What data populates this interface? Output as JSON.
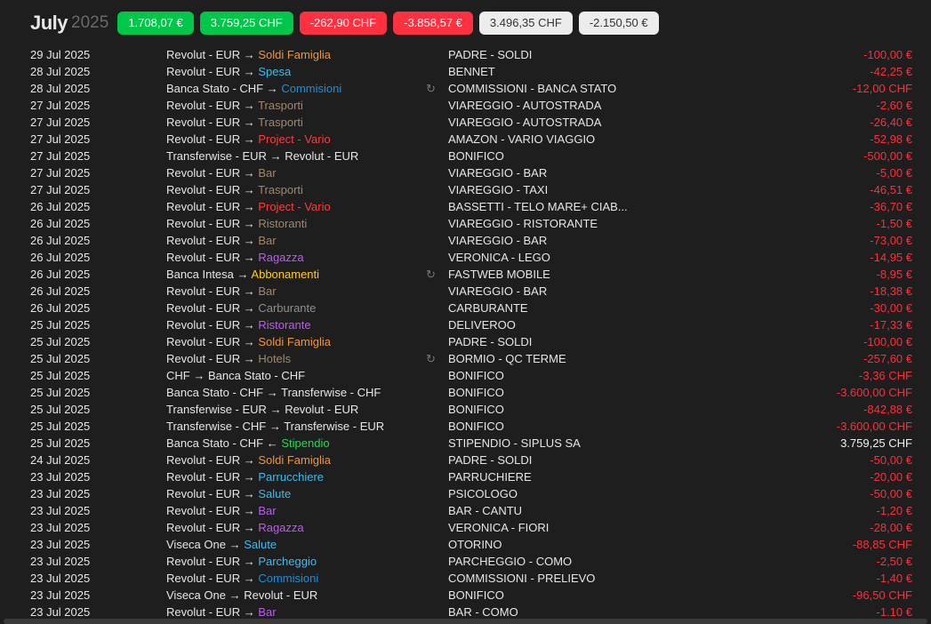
{
  "header": {
    "month": "July",
    "year": "2025",
    "pills": [
      {
        "label": "1.708,07 €",
        "style": "green"
      },
      {
        "label": "3.759,25 CHF",
        "style": "green"
      },
      {
        "label": "-262,90 CHF",
        "style": "red"
      },
      {
        "label": "-3.858,57 €",
        "style": "red"
      },
      {
        "label": "3.496,35 CHF",
        "style": "neutral"
      },
      {
        "label": "-2.150,50 €",
        "style": "neutral"
      }
    ]
  },
  "colors": {
    "expense": "#ff2d3a",
    "income": "#f0f0f0",
    "text": "#e6e6e6",
    "Soldi Famiglia": "#f39436",
    "Spesa": "#3fbbed",
    "Commisioni": "#1d8fd6",
    "Trasporti": "#a3876a",
    "Bar": "#a3876a",
    "Ristoranti": "#a3876a",
    "Hotels": "#a3876a",
    "Project - Vario": "#ff3b3b",
    "Ragazza": "#bf5af2",
    "Ristorante": "#bf5af2",
    "Abbonamenti": "#ffcc1a",
    "Carburante": "#8e8e8e",
    "Stipendio": "#30d158",
    "Parrucchiere": "#3fbbed",
    "Salute": "#3fbbed",
    "Parcheggio": "#3fbbed",
    "BarPurple": "#bf5af2"
  },
  "recurring_icon": "repeat-icon",
  "transactions": [
    {
      "date": "29 Jul 2025",
      "from": "Revolut - EUR",
      "arrow": "→",
      "to": "Soldi Famiglia",
      "to_color": "#f39436",
      "recurring": false,
      "desc": "PADRE - SOLDI",
      "amount": "-100,00 €",
      "type": "expense"
    },
    {
      "date": "28 Jul 2025",
      "from": "Revolut - EUR",
      "arrow": "→",
      "to": "Spesa",
      "to_color": "#3fbbed",
      "recurring": false,
      "desc": "BENNET",
      "amount": "-42,25 €",
      "type": "expense"
    },
    {
      "date": "28 Jul 2025",
      "from": "Banca Stato - CHF",
      "arrow": "→",
      "to": "Commisioni",
      "to_color": "#1d8fd6",
      "recurring": true,
      "desc": "COMMISSIONI - BANCA STATO",
      "amount": "-12,00 CHF",
      "type": "expense"
    },
    {
      "date": "27 Jul 2025",
      "from": "Revolut - EUR",
      "arrow": "→",
      "to": "Trasporti",
      "to_color": "#a3876a",
      "recurring": false,
      "desc": "VIAREGGIO - AUTOSTRADA",
      "amount": "-2,60 €",
      "type": "expense"
    },
    {
      "date": "27 Jul 2025",
      "from": "Revolut - EUR",
      "arrow": "→",
      "to": "Trasporti",
      "to_color": "#a3876a",
      "recurring": false,
      "desc": "VIAREGGIO - AUTOSTRADA",
      "amount": "-26,40 €",
      "type": "expense"
    },
    {
      "date": "27 Jul 2025",
      "from": "Revolut - EUR",
      "arrow": "→",
      "to": "Project - Vario",
      "to_color": "#ff3b3b",
      "recurring": false,
      "desc": "AMAZON - VARIO VIAGGIO",
      "amount": "-52,98 €",
      "type": "expense"
    },
    {
      "date": "27 Jul 2025",
      "from": "Transferwise - EUR",
      "arrow": "→",
      "to": "Revolut - EUR",
      "to_color": "#e6e6e6",
      "recurring": false,
      "desc": "BONIFICO",
      "amount": "-500,00 €",
      "type": "expense"
    },
    {
      "date": "27 Jul 2025",
      "from": "Revolut - EUR",
      "arrow": "→",
      "to": "Bar",
      "to_color": "#a3876a",
      "recurring": false,
      "desc": "VIAREGGIO - BAR",
      "amount": "-5,00 €",
      "type": "expense"
    },
    {
      "date": "27 Jul 2025",
      "from": "Revolut - EUR",
      "arrow": "→",
      "to": "Trasporti",
      "to_color": "#a3876a",
      "recurring": false,
      "desc": "VIAREGGIO - TAXI",
      "amount": "-46,51 €",
      "type": "expense"
    },
    {
      "date": "26 Jul 2025",
      "from": "Revolut - EUR",
      "arrow": "→",
      "to": "Project - Vario",
      "to_color": "#ff3b3b",
      "recurring": false,
      "desc": "BASSETTI - TELO MARE+ CIAB...",
      "amount": "-36,70 €",
      "type": "expense"
    },
    {
      "date": "26 Jul 2025",
      "from": "Revolut - EUR",
      "arrow": "→",
      "to": "Ristoranti",
      "to_color": "#a3876a",
      "recurring": false,
      "desc": "VIAREGGIO - RISTORANTE",
      "amount": "-1,50 €",
      "type": "expense"
    },
    {
      "date": "26 Jul 2025",
      "from": "Revolut - EUR",
      "arrow": "→",
      "to": "Bar",
      "to_color": "#a3876a",
      "recurring": false,
      "desc": "VIAREGGIO - BAR",
      "amount": "-73,00 €",
      "type": "expense"
    },
    {
      "date": "26 Jul 2025",
      "from": "Revolut - EUR",
      "arrow": "→",
      "to": "Ragazza",
      "to_color": "#bf5af2",
      "recurring": false,
      "desc": "VERONICA - LEGO",
      "amount": "-14,95 €",
      "type": "expense"
    },
    {
      "date": "26 Jul 2025",
      "from": "Banca Intesa",
      "arrow": "→",
      "to": "Abbonamenti",
      "to_color": "#ffcc1a",
      "recurring": true,
      "desc": "FASTWEB MOBILE",
      "amount": "-8,95 €",
      "type": "expense"
    },
    {
      "date": "26 Jul 2025",
      "from": "Revolut - EUR",
      "arrow": "→",
      "to": "Bar",
      "to_color": "#a3876a",
      "recurring": false,
      "desc": "VIAREGGIO - BAR",
      "amount": "-18,38 €",
      "type": "expense"
    },
    {
      "date": "26 Jul 2025",
      "from": "Revolut - EUR",
      "arrow": "→",
      "to": "Carburante",
      "to_color": "#8e8e8e",
      "recurring": false,
      "desc": "CARBURANTE",
      "amount": "-30,00 €",
      "type": "expense"
    },
    {
      "date": "25 Jul 2025",
      "from": "Revolut - EUR",
      "arrow": "→",
      "to": "Ristorante",
      "to_color": "#bf5af2",
      "recurring": false,
      "desc": "DELIVEROO",
      "amount": "-17,33 €",
      "type": "expense"
    },
    {
      "date": "25 Jul 2025",
      "from": "Revolut - EUR",
      "arrow": "→",
      "to": "Soldi Famiglia",
      "to_color": "#f39436",
      "recurring": false,
      "desc": "PADRE - SOLDI",
      "amount": "-100,00 €",
      "type": "expense"
    },
    {
      "date": "25 Jul 2025",
      "from": "Revolut - EUR",
      "arrow": "→",
      "to": "Hotels",
      "to_color": "#a3876a",
      "recurring": true,
      "desc": "BORMIO - QC TERME",
      "amount": "-257,60 €",
      "type": "expense"
    },
    {
      "date": "25 Jul 2025",
      "from": "CHF",
      "arrow": "→",
      "to": "Banca Stato - CHF",
      "to_color": "#e6e6e6",
      "recurring": false,
      "desc": "BONIFICO",
      "amount": "-3,36 CHF",
      "type": "expense"
    },
    {
      "date": "25 Jul 2025",
      "from": "Banca Stato - CHF",
      "arrow": "→",
      "to": "Transferwise - CHF",
      "to_color": "#e6e6e6",
      "recurring": false,
      "desc": "BONIFICO",
      "amount": "-3.600,00 CHF",
      "type": "expense"
    },
    {
      "date": "25 Jul 2025",
      "from": "Transferwise - EUR",
      "arrow": "→",
      "to": "Revolut - EUR",
      "to_color": "#e6e6e6",
      "recurring": false,
      "desc": "BONIFICO",
      "amount": "-842,88 €",
      "type": "expense"
    },
    {
      "date": "25 Jul 2025",
      "from": "Transferwise - CHF",
      "arrow": "→",
      "to": "Transferwise - EUR",
      "to_color": "#e6e6e6",
      "recurring": false,
      "desc": "BONIFICO",
      "amount": "-3.600,00 CHF",
      "type": "expense"
    },
    {
      "date": "25 Jul 2025",
      "from": "Banca Stato - CHF",
      "arrow": "←",
      "to": "Stipendio",
      "to_color": "#30d158",
      "recurring": false,
      "desc": "STIPENDIO - SIPLUS SA",
      "amount": "3.759,25 CHF",
      "type": "income"
    },
    {
      "date": "24 Jul 2025",
      "from": "Revolut - EUR",
      "arrow": "→",
      "to": "Soldi Famiglia",
      "to_color": "#f39436",
      "recurring": false,
      "desc": "PADRE - SOLDI",
      "amount": "-50,00 €",
      "type": "expense"
    },
    {
      "date": "23 Jul 2025",
      "from": "Revolut - EUR",
      "arrow": "→",
      "to": "Parrucchiere",
      "to_color": "#3fbbed",
      "recurring": false,
      "desc": "PARRUCHIERE",
      "amount": "-20,00 €",
      "type": "expense"
    },
    {
      "date": "23 Jul 2025",
      "from": "Revolut - EUR",
      "arrow": "→",
      "to": "Salute",
      "to_color": "#3fbbed",
      "recurring": false,
      "desc": "PSICOLOGO",
      "amount": "-50,00 €",
      "type": "expense"
    },
    {
      "date": "23 Jul 2025",
      "from": "Revolut - EUR",
      "arrow": "→",
      "to": "Bar",
      "to_color": "#bf5af2",
      "recurring": false,
      "desc": "BAR - CANTU",
      "amount": "-1,20 €",
      "type": "expense"
    },
    {
      "date": "23 Jul 2025",
      "from": "Revolut - EUR",
      "arrow": "→",
      "to": "Ragazza",
      "to_color": "#bf5af2",
      "recurring": false,
      "desc": "VERONICA - FIORI",
      "amount": "-28,00 €",
      "type": "expense"
    },
    {
      "date": "23 Jul 2025",
      "from": "Viseca One",
      "arrow": "→",
      "to": "Salute",
      "to_color": "#3fbbed",
      "recurring": false,
      "desc": "OTORINO",
      "amount": "-88,85 CHF",
      "type": "expense"
    },
    {
      "date": "23 Jul 2025",
      "from": "Revolut - EUR",
      "arrow": "→",
      "to": "Parcheggio",
      "to_color": "#3fbbed",
      "recurring": false,
      "desc": "PARCHEGGIO - COMO",
      "amount": "-2,50 €",
      "type": "expense"
    },
    {
      "date": "23 Jul 2025",
      "from": "Revolut - EUR",
      "arrow": "→",
      "to": "Commisioni",
      "to_color": "#1d8fd6",
      "recurring": false,
      "desc": "COMMISSIONI - PRELIEVO",
      "amount": "-1,40 €",
      "type": "expense"
    },
    {
      "date": "23 Jul 2025",
      "from": "Viseca One",
      "arrow": "→",
      "to": "Revolut - EUR",
      "to_color": "#e6e6e6",
      "recurring": false,
      "desc": "BONIFICO",
      "amount": "-96,50 CHF",
      "type": "expense"
    },
    {
      "date": "23 Jul 2025",
      "from": "Revolut - EUR",
      "arrow": "→",
      "to": "Bar",
      "to_color": "#bf5af2",
      "recurring": false,
      "desc": "BAR - COMO",
      "amount": "-1.10 €",
      "type": "expense"
    }
  ]
}
